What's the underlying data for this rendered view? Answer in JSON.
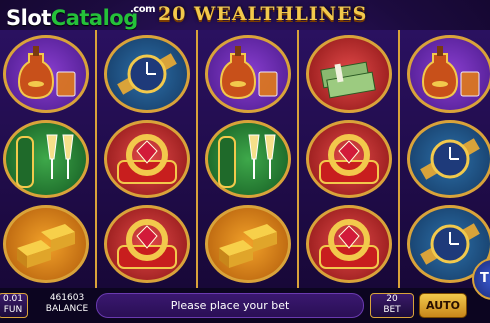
{
  "logo": {
    "slot": "Slot",
    "catalog": "Catalog",
    "com": ".com"
  },
  "game": {
    "title": "20 WEALTHLINES"
  },
  "reels": [
    [
      "cognac",
      "champagne",
      "gold-bars"
    ],
    [
      "watch",
      "ring",
      "ring"
    ],
    [
      "cognac",
      "champagne",
      "gold-bars"
    ],
    [
      "money-stack",
      "ring",
      "ring"
    ],
    [
      "cognac",
      "watch",
      "watch"
    ]
  ],
  "footer": {
    "fun_value": "0.01",
    "fun_label": "FUN",
    "balance_value": "461603",
    "balance_label": "BALANCE",
    "message": "Please place your bet",
    "bet_value": "20",
    "bet_label": "BET",
    "auto_label": "AUTO",
    "spin_label": "T"
  }
}
